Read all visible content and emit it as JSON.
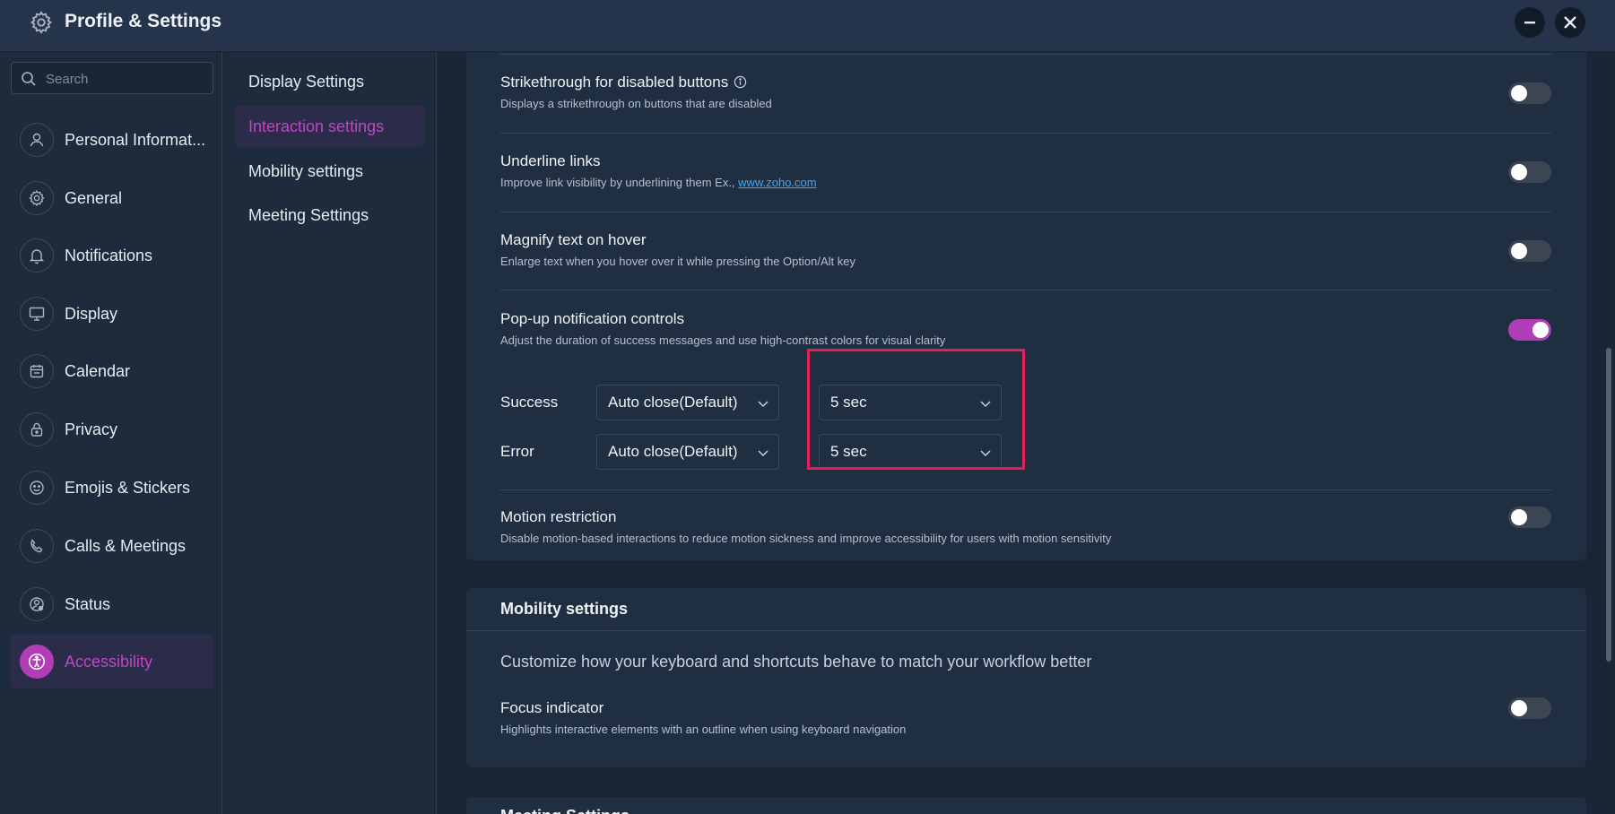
{
  "window": {
    "title": "Profile & Settings",
    "settings_icon": "gear-icon",
    "minimize_icon": "minus-icon",
    "close_icon": "close-icon"
  },
  "search": {
    "placeholder": "Search"
  },
  "nav": {
    "items": [
      {
        "label": "Personal Informat...",
        "icon": "user-icon"
      },
      {
        "label": "General",
        "icon": "gear-icon"
      },
      {
        "label": "Notifications",
        "icon": "bell-icon"
      },
      {
        "label": "Display",
        "icon": "monitor-icon"
      },
      {
        "label": "Calendar",
        "icon": "calendar-icon"
      },
      {
        "label": "Privacy",
        "icon": "lock-icon"
      },
      {
        "label": "Emojis & Stickers",
        "icon": "smiley-icon"
      },
      {
        "label": "Calls & Meetings",
        "icon": "phone-icon"
      },
      {
        "label": "Status",
        "icon": "user-status-icon"
      },
      {
        "label": "Accessibility",
        "icon": "accessibility-icon"
      }
    ],
    "active": "Accessibility"
  },
  "subnav": {
    "items": [
      {
        "label": "Display Settings"
      },
      {
        "label": "Interaction settings"
      },
      {
        "label": "Mobility settings"
      },
      {
        "label": "Meeting Settings"
      }
    ],
    "active": "Interaction settings"
  },
  "interaction": {
    "strikethrough": {
      "title": "Strikethrough for disabled buttons",
      "desc": "Displays a strikethrough on buttons that are disabled",
      "enabled": false
    },
    "underline": {
      "title": "Underline links",
      "desc_prefix": "Improve link visibility by underlining them Ex., ",
      "link": "www.zoho.com",
      "enabled": false
    },
    "magnify": {
      "title": "Magnify text on hover",
      "desc": "Enlarge text when you hover over it while pressing the Option/Alt key",
      "enabled": false
    },
    "popup": {
      "title": "Pop-up notification controls",
      "desc": "Adjust the duration of success messages and use high-contrast colors for visual clarity",
      "enabled": true,
      "success_label": "Success",
      "success_mode": "Auto close(Default)",
      "success_duration": "5 sec",
      "error_label": "Error",
      "error_mode": "Auto close(Default)",
      "error_duration": "5 sec"
    },
    "motion": {
      "title": "Motion restriction",
      "desc": "Disable motion-based interactions to reduce motion sickness and improve accessibility for users with motion sensitivity",
      "enabled": false
    }
  },
  "mobility": {
    "title": "Mobility settings",
    "lead": "Customize how your keyboard and shortcuts behave to match your workflow better",
    "focus": {
      "title": "Focus indicator",
      "desc": "Highlights interactive elements with an outline when using keyboard navigation",
      "enabled": false
    }
  },
  "meeting": {
    "title": "Meeting Settings"
  },
  "colors": {
    "accent": "#b03eb6",
    "highlight": "#e11d5a",
    "link": "#3fa9f5"
  }
}
